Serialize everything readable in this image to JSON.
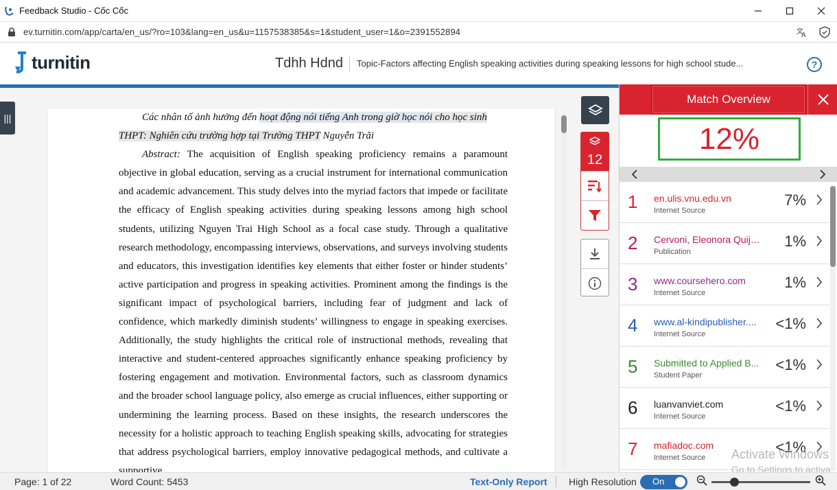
{
  "window": {
    "title": "Feedback Studio - Cốc Cốc",
    "minimize_icon": "minimize-icon",
    "maximize_icon": "maximize-icon",
    "close_icon": "close-icon"
  },
  "address_bar": {
    "url": "ev.turnitin.com/app/carta/en_us/?ro=103&lang=en_us&u=1157538385&s=1&student_user=1&o=2391552894"
  },
  "header": {
    "logo_text": "turnitin",
    "student_name": "Tdhh Hdnd",
    "doc_title": "Topic-Factors affecting English speaking activities during speaking lessons for high school stude..."
  },
  "document": {
    "title_plain": "Các nhân tố ảnh hưởng đến ",
    "title_hl1": "hoạt động nói tiếng Anh trong giờ học nói",
    "title_mid": " cho học sinh",
    "title_hl2": "THPT: Nghiên cứu trường hợp tại Trường THPT",
    "title_end": " Nguyễn Trãi",
    "abstract_head": "Abstract:",
    "abstract_body": " The acquisition of English speaking proficiency remains a paramount objective in global education, serving as a crucial instrument for international communication and academic advancement. This study delves into the myriad factors that impede or facilitate the efficacy of English speaking activities during speaking lessons among high school students, utilizing Nguyen Trai High School as a focal case study. Through a qualitative research methodology, encompassing interviews, observations, and surveys involving students and educators, this investigation identifies key elements that either foster or hinder students’ active participation and progress in speaking activities. Prominent among the findings is the significant impact of psychological barriers, including fear of judgment and lack of confidence, which markedly diminish students’ willingness to engage in speaking exercises. Additionally, the study highlights the critical role of instructional methods, revealing that interactive and student-centered approaches significantly enhance speaking proficiency by fostering engagement and motivation. Environmental factors, such as classroom dynamics and the broader school language policy, also emerge as crucial influences, either supporting or undermining the learning process. Based on these insights, the research underscores the necessity for a holistic approach to teaching English speaking skills, advocating for strategies that address psychological barriers, employ innovative pedagogical methods, and cultivate a supportive"
  },
  "toolbar": {
    "match_count": "12"
  },
  "panel": {
    "title": "Match Overview",
    "overall_percent": "12%",
    "matches": [
      {
        "rank": "1",
        "source": "en.ulis.vnu.edu.vn",
        "type": "Internet Source",
        "percent": "7%",
        "color": "#d9232e"
      },
      {
        "rank": "2",
        "source": "Cervoni, Eleonora Quija...",
        "type": "Publication",
        "percent": "1%",
        "color": "#c2185b"
      },
      {
        "rank": "3",
        "source": "www.coursehero.com",
        "type": "Internet Source",
        "percent": "1%",
        "color": "#8e2a8e"
      },
      {
        "rank": "4",
        "source": "www.al-kindipublisher....",
        "type": "Internet Source",
        "percent": "<1%",
        "color": "#2a5db0"
      },
      {
        "rank": "5",
        "source": "Submitted to Applied B...",
        "type": "Student Paper",
        "percent": "<1%",
        "color": "#3a8a2e"
      },
      {
        "rank": "6",
        "source": "luanvanviet.com",
        "type": "Internet Source",
        "percent": "<1%",
        "color": "#222222"
      },
      {
        "rank": "7",
        "source": "mafiadoc.com",
        "type": "Internet Source",
        "percent": "<1%",
        "color": "#d9232e"
      }
    ]
  },
  "watermark": {
    "line1": "Activate Windows",
    "line2": "Go to Settings to activa"
  },
  "status": {
    "page": "Page: 1 of 22",
    "word_count": "Word Count: 5453",
    "text_only": "Text-Only Report",
    "high_res": "High Resolution",
    "toggle": "On"
  }
}
